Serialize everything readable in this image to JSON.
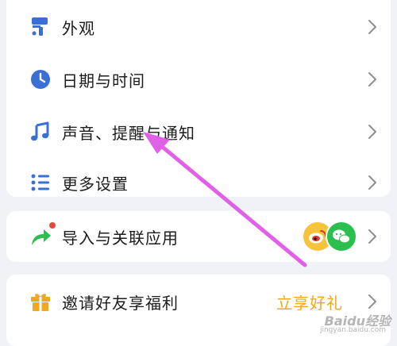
{
  "settings": {
    "items": [
      {
        "label": "外观",
        "icon": "paint-roller-icon"
      },
      {
        "label": "日期与时间",
        "icon": "clock-icon"
      },
      {
        "label": "声音、提醒与通知",
        "icon": "music-note-icon"
      },
      {
        "label": "更多设置",
        "icon": "list-icon"
      }
    ]
  },
  "import": {
    "label": "导入与关联应用",
    "icon": "share-arrow-icon",
    "badges": [
      "weibo-icon",
      "wechat-icon"
    ]
  },
  "invite": {
    "label": "邀请好友享福利",
    "icon": "gift-icon",
    "action_label": "立享好礼"
  },
  "watermark": {
    "text": "Baidu经验",
    "sub": "jingyan.baidu.com"
  },
  "colors": {
    "accent": "#3b6fd4",
    "green": "#2bbf4f",
    "annotation": "#e060e8",
    "gift": "#f0a81e"
  }
}
